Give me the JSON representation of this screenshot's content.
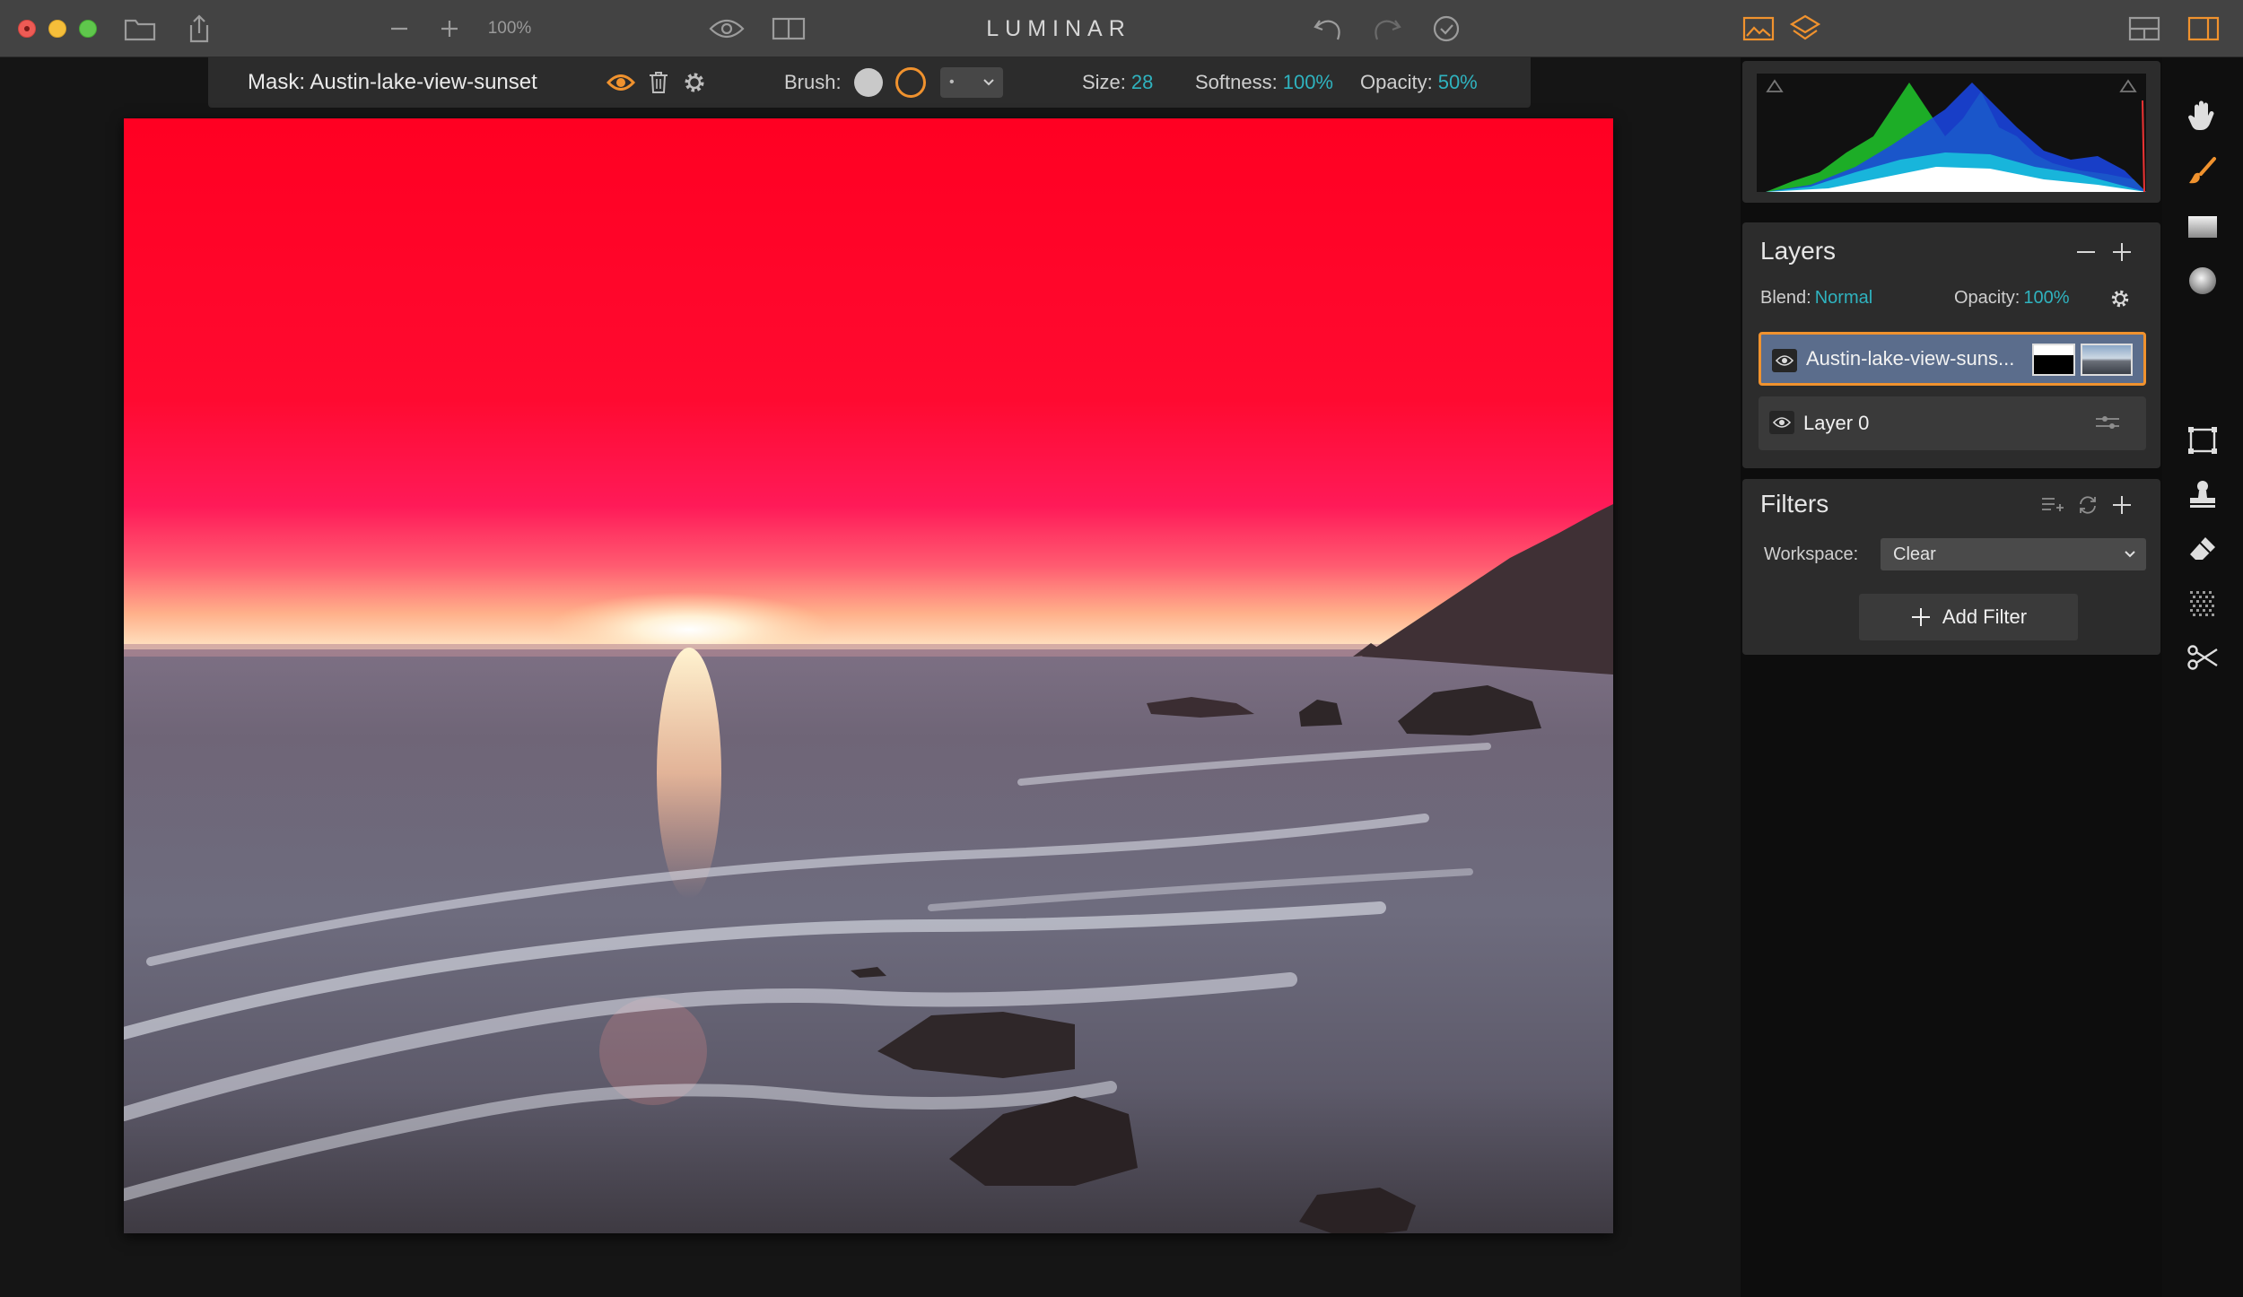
{
  "app": {
    "title": "LUMINAR",
    "zoom_label": "100%"
  },
  "mask_bar": {
    "title": "Mask: Austin-lake-view-sunset",
    "brush_label": "Brush:",
    "size_label": "Size:",
    "size_value": "28",
    "softness_label": "Softness:",
    "softness_value": "100%",
    "opacity_label": "Opacity:",
    "opacity_value": "50%",
    "brush_select_value": "•"
  },
  "layers": {
    "title": "Layers",
    "blend_label": "Blend:",
    "blend_value": "Normal",
    "opacity_label": "Opacity:",
    "opacity_value": "100%",
    "items": [
      {
        "name": "Austin-lake-view-suns..."
      },
      {
        "name": "Layer 0"
      }
    ]
  },
  "filters": {
    "title": "Filters",
    "workspace_label": "Workspace:",
    "workspace_value": "Clear",
    "add_filter_label": "Add Filter"
  },
  "colors": {
    "accent_orange": "#f0922e",
    "accent_teal": "#2fb3bf",
    "mask_red": "#ff0022"
  },
  "icons": {
    "toolbar_left": [
      "folder-icon",
      "share-icon",
      "zoom-out-icon",
      "zoom-in-icon"
    ],
    "toolbar_center": [
      "preview-eye-icon",
      "compare-icon",
      "undo-icon",
      "redo-icon",
      "history-icon"
    ],
    "toolbar_right": [
      "image-icon",
      "layers-icon",
      "layout-icon",
      "sidebar-toggle-icon"
    ],
    "tools": [
      "hand-icon",
      "brush-icon",
      "gradient-icon",
      "radial-mask-icon",
      "transform-icon",
      "clone-stamp-icon",
      "erase-icon",
      "noise-icon",
      "crop-icon"
    ]
  }
}
